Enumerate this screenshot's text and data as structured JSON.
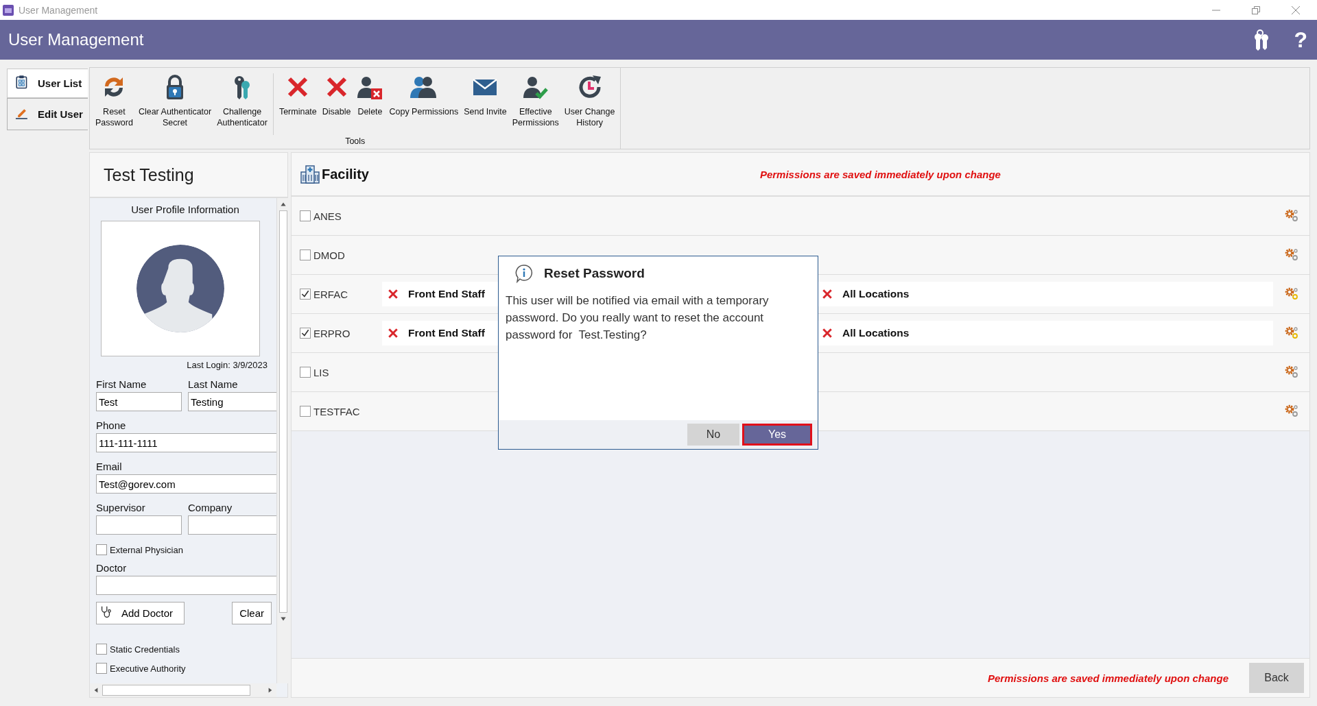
{
  "window": {
    "title": "User Management"
  },
  "header": {
    "title": "User Management",
    "help": "?"
  },
  "nav_tabs": [
    {
      "label": "User List",
      "selected": false
    },
    {
      "label": "Edit User",
      "selected": true
    }
  ],
  "toolbar": {
    "label": "Tools",
    "groups": [
      {
        "buttons": [
          {
            "label": "Reset\nPassword"
          },
          {
            "label": "Clear Authenticator\nSecret"
          },
          {
            "label": "Challenge\nAuthenticator"
          }
        ]
      },
      {
        "buttons": [
          {
            "label": "Terminate"
          },
          {
            "label": "Disable"
          },
          {
            "label": "Delete"
          },
          {
            "label": "Copy Permissions"
          },
          {
            "label": "Send Invite"
          },
          {
            "label": "Effective\nPermissions"
          },
          {
            "label": "User Change\nHistory"
          }
        ]
      }
    ]
  },
  "profile": {
    "name": "Test Testing",
    "section_title": "User Profile Information",
    "last_login": "Last Login: 3/9/2023",
    "form": [
      {
        "kind": "pair",
        "fields": [
          {
            "label": "First Name",
            "value": "Test"
          },
          {
            "label": "Last Name",
            "value": "Testing"
          }
        ]
      },
      {
        "kind": "field",
        "label": "Phone",
        "value": "111-111-1111"
      },
      {
        "kind": "field",
        "label": "Email",
        "value": "Test@gorev.com"
      },
      {
        "kind": "pair",
        "fields": [
          {
            "label": "Supervisor"
          },
          {
            "label": "Company"
          }
        ]
      },
      {
        "kind": "checkbox",
        "label": "External Physician",
        "checked": false
      },
      {
        "kind": "field",
        "label": "Doctor"
      },
      {
        "kind": "buttons",
        "buttons": [
          {
            "label": "Add Doctor"
          },
          {
            "label": "Clear"
          }
        ]
      },
      {
        "kind": "checkbox",
        "label": "Static Credentials",
        "checked": false
      },
      {
        "kind": "checkbox",
        "label": "Executive Authority",
        "checked": false
      }
    ]
  },
  "facility": {
    "title": "Facility",
    "note": "Permissions are saved immediately upon change",
    "rows": [
      {
        "name": "ANES",
        "checked": false
      },
      {
        "name": "DMOD",
        "checked": false
      },
      {
        "name": "ERFAC",
        "checked": true,
        "role": "Front End Staff",
        "location": "All Locations"
      },
      {
        "name": "ERPRO",
        "checked": true,
        "role": "Front End Staff",
        "location": "All Locations"
      },
      {
        "name": "LIS",
        "checked": false
      },
      {
        "name": "TESTFAC",
        "checked": false
      }
    ],
    "footer_note": "Permissions are saved immediately upon change",
    "back": "Back"
  },
  "dialog": {
    "title": "Reset Password",
    "message": "This user will be notified via email with a temporary password. Do you really want to reset the account password for  Test.Testing?",
    "buttons": [
      {
        "label": "No",
        "primary": false,
        "focused": false
      },
      {
        "label": "Yes",
        "primary": true,
        "focused": true
      }
    ]
  }
}
